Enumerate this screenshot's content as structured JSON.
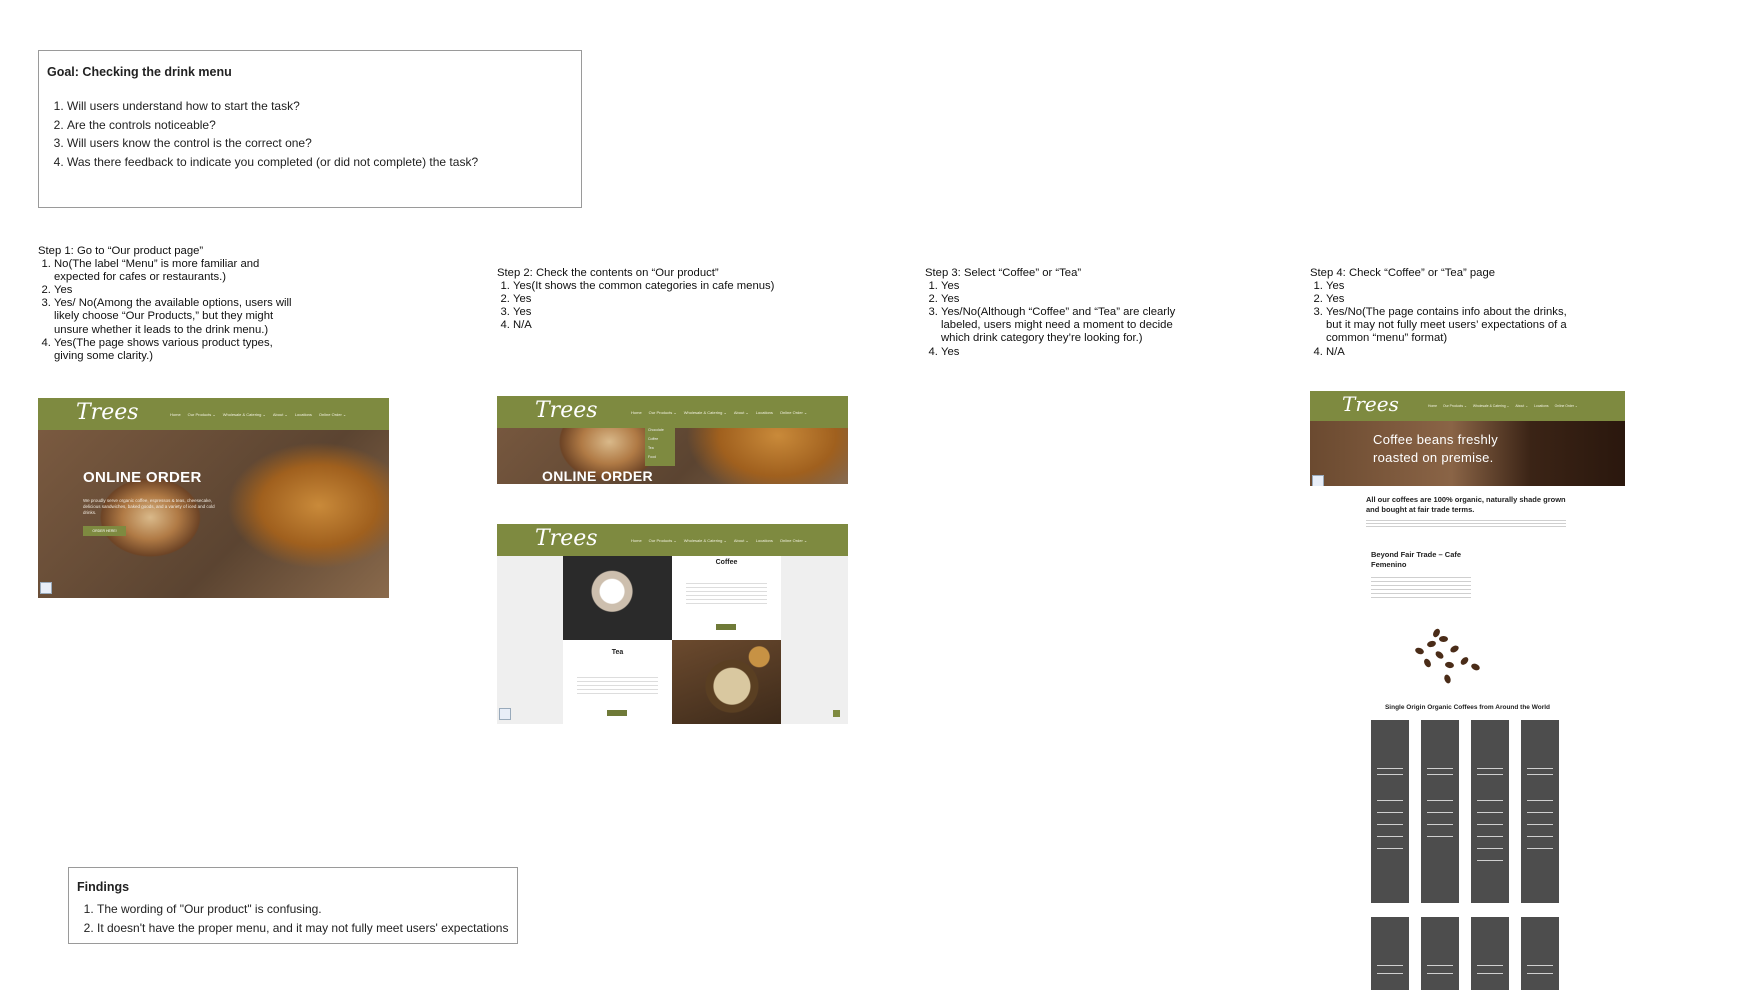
{
  "goal": {
    "title": "Goal: Checking the drink menu",
    "questions": [
      "Will users understand how to start the task?",
      "Are the controls noticeable?",
      "Will users know the control is the correct one?",
      "Was there feedback to indicate you completed (or did not complete) the task?"
    ]
  },
  "steps": [
    {
      "title": "Step 1: Go to “Our product page”",
      "answers": [
        "No(The label “Menu” is more familiar and expected for cafes or restaurants.)",
        "Yes",
        "Yes/ No(Among the available options, users will likely choose “Our Products,” but they might unsure whether it leads to the drink menu.)",
        "Yes(The page shows various product types, giving some clarity.)"
      ]
    },
    {
      "title": "Step 2: Check the contents on “Our product”",
      "answers": [
        "Yes(It shows the common categories in cafe menus)",
        "Yes",
        "Yes",
        "N/A"
      ]
    },
    {
      "title": "Step 3: Select “Coffee” or “Tea”",
      "answers": [
        "Yes",
        "Yes",
        "Yes/No(Although “Coffee” and “Tea” are clearly labeled, users might need a moment to decide which drink category they’re looking for.)",
        "Yes"
      ]
    },
    {
      "title": "Step 4: Check “Coffee” or “Tea” page",
      "answers": [
        "Yes",
        "Yes",
        "Yes/No(The page contains info about the drinks, but it may not fully meet users’ expectations of a common “menu” format)",
        "N/A"
      ]
    }
  ],
  "findings": {
    "title": "Findings",
    "items": [
      "The wording of \"Our product\" is confusing.",
      "It doesn't have the proper menu, and it may not fully meet users' expectations"
    ]
  },
  "site": {
    "logo": "Trees",
    "nav": [
      "Home",
      "Our Products ⌄",
      "Wholesale & Catering ⌄",
      "About ⌄",
      "Locations",
      "Online Order ⌄"
    ],
    "dropdown": [
      "Chocolate",
      "Coffee",
      "Tea",
      "Food"
    ],
    "hero_title": "ONLINE ORDER",
    "hero_text": "We proudly serve organic coffee, espressos & teas, cheesecake, delicious sandwiches, baked goods, and a variety of iced and cold drinks.",
    "hero_button": "ORDER HERE!",
    "coffee_label": "Coffee",
    "tea_label": "Tea",
    "coffee_hero": "Coffee beans freshly roasted on premise.",
    "coffee_heading": "All our coffees are 100% organic, naturally shade grown and bought at fair trade terms.",
    "fair_trade_heading": "Beyond Fair Trade – Cafe Femenino",
    "single_origin": "Single Origin Organic Coffees from Around the World"
  },
  "colors": {
    "brand_green": "#7e8a40",
    "card_gray": "#4d4d4d"
  }
}
